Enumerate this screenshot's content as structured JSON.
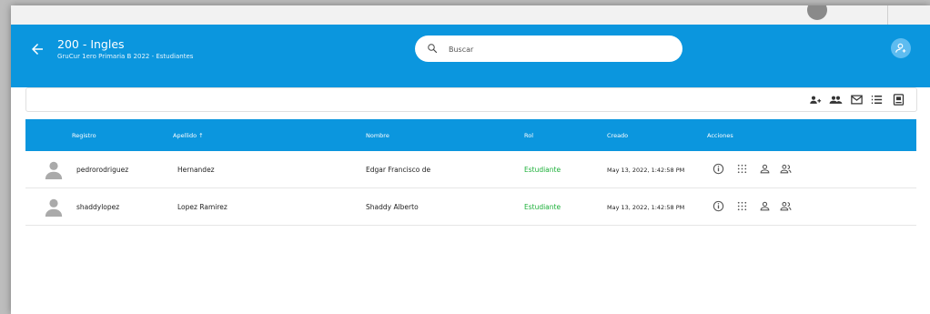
{
  "header": {
    "title": "200 - Ingles",
    "subtitle": "GruCur 1ero Primaria B 2022 - Estudiantes",
    "search_placeholder": "Buscar"
  },
  "toolbar": {
    "icons": [
      "group-add-icon",
      "group-icon",
      "email-icon",
      "list-icon",
      "export-icon"
    ]
  },
  "table": {
    "columns": {
      "registro": "Registro",
      "apellido": "Apellido ↑",
      "nombre": "Nombre",
      "rol": "Rol",
      "creado": "Creado",
      "acciones": "Acciones"
    },
    "rows": [
      {
        "registro": "pedrorodriguez",
        "apellido": "Hernandez",
        "nombre": "Edgar Francisco de",
        "rol": "Estudiante",
        "creado": "May 13, 2022, 1:42:58 PM"
      },
      {
        "registro": "shaddylopez",
        "apellido": "Lopez Ramirez",
        "nombre": "Shaddy Alberto",
        "rol": "Estudiante",
        "creado": "May 13, 2022, 1:42:58 PM"
      }
    ],
    "actions": [
      "info-icon",
      "grid-icon",
      "person-icon",
      "group-icon"
    ]
  },
  "colors": {
    "primary": "#0b96de",
    "role_green": "#1db03a"
  }
}
